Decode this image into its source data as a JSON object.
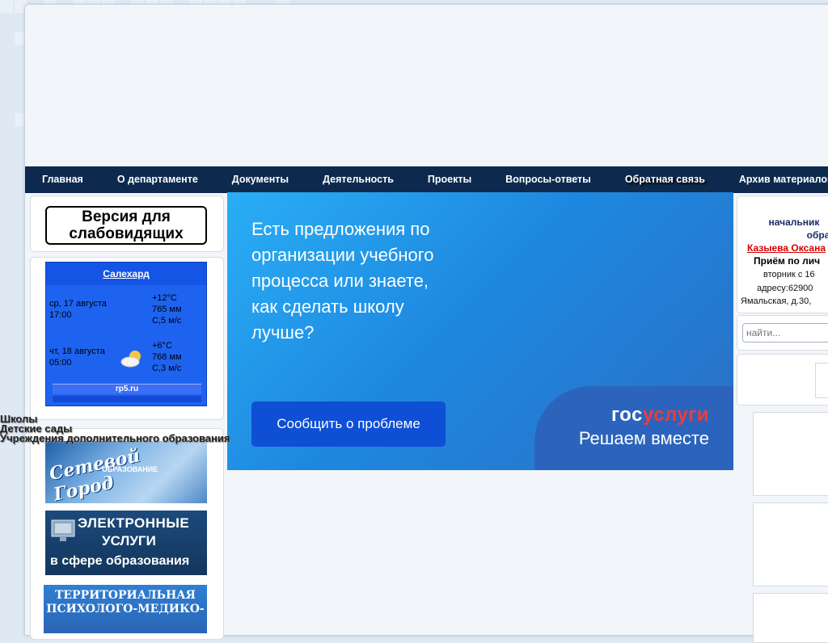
{
  "nav": {
    "items": [
      {
        "label": "Главная"
      },
      {
        "label": "О департаменте"
      },
      {
        "label": "Документы"
      },
      {
        "label": "Деятельность"
      },
      {
        "label": "Проекты"
      },
      {
        "label": "Вопросы-ответы"
      },
      {
        "label": "Обратная связь"
      },
      {
        "label": "Архив материалов"
      }
    ]
  },
  "left": {
    "vision_button": "Версия для слабовидящих",
    "weather": {
      "city": "Салехард",
      "day1": {
        "date": "ср, 17 августа",
        "time": "17:00",
        "temp": "+12°C",
        "pressure": "765 мм",
        "wind": "С,5 м/с"
      },
      "day2": {
        "date": "чт, 18 августа",
        "time": "05:00",
        "temp": "+6°C",
        "pressure": "768 мм",
        "wind": "С,3 м/с"
      },
      "source": "rp5.ru"
    },
    "links": [
      "Школы",
      "Детские сады",
      "Учреждения дополнительного образования"
    ],
    "net_banner": {
      "title": "Сетевой Город",
      "sub": "ОБРАЗОВАНИЕ"
    },
    "eserv_banner": {
      "l1": "ЭЛЕКТРОННЫЕ",
      "l2": "УСЛУГИ",
      "l3": "в сфере образования"
    },
    "terr_banner": {
      "l1": "ТЕРРИТОРИАЛЬНАЯ",
      "l2": "ПСИХОЛОГО-МЕДИКО-"
    }
  },
  "hero": {
    "question": "Есть предложения по организации учебного процесса или знаете, как сделать школу лучше?",
    "button": "Сообщить о проблеме",
    "brand_a": "гос",
    "brand_b": "услуги",
    "tagline": "Решаем вместе"
  },
  "right": {
    "line1": "начальник",
    "line2": "обра",
    "name": "Казыева Оксана",
    "reception": "Приём по лич",
    "day": "вторник с 16",
    "address1": "адресу:62900",
    "address2": "Ямальская, д.30,",
    "search_placeholder": "найти..."
  },
  "colors": {
    "navbar": "#0d2a4e",
    "hero_button": "#0e4fd6",
    "brand_red": "#ef3b3b",
    "name_red": "#d40000"
  }
}
